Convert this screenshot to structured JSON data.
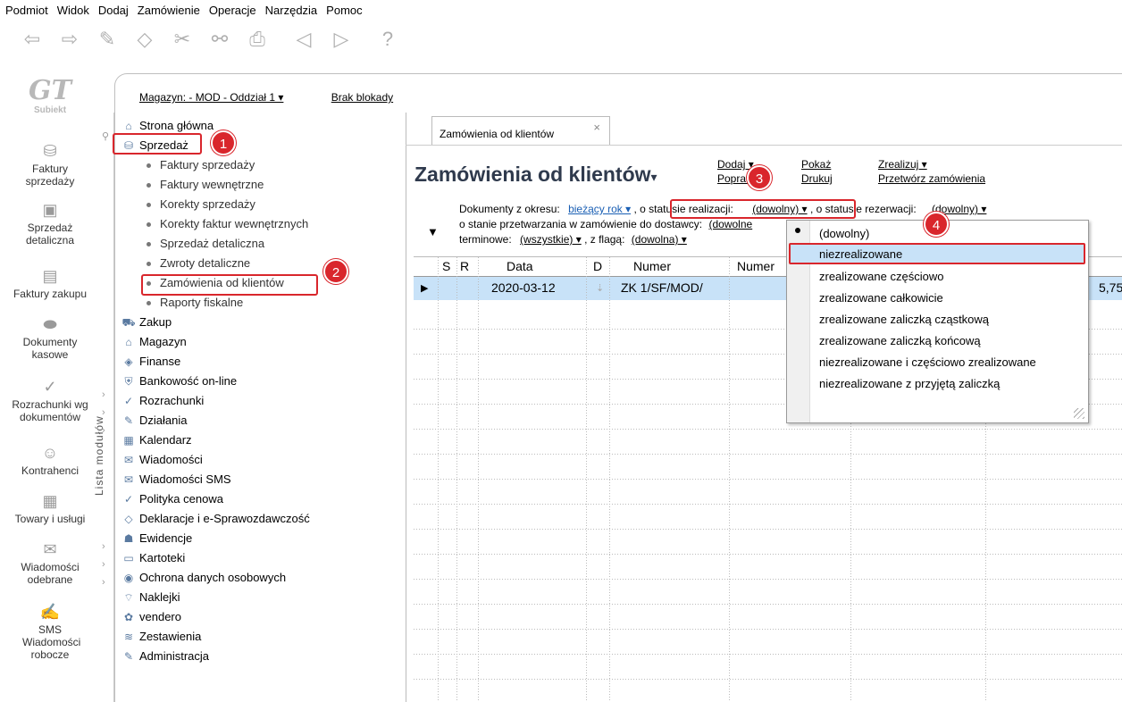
{
  "menu": [
    "Podmiot",
    "Widok",
    "Dodaj",
    "Zamówienie",
    "Operacje",
    "Narzędzia",
    "Pomoc"
  ],
  "toolbar_icons": [
    "back-icon",
    "forward-icon",
    "pen-icon",
    "eraser-icon",
    "tools-icon",
    "link-icon",
    "print-icon",
    "prev-record-icon",
    "next-record-icon",
    "help-icon"
  ],
  "logo": {
    "mark": "GT",
    "name": "Subiekt"
  },
  "rail": [
    {
      "label": "Faktury sprzedaży",
      "icon": "coins-icon"
    },
    {
      "label": "Sprzedaż detaliczna",
      "icon": "register-icon"
    },
    {
      "label": "Faktury zakupu",
      "icon": "invoice-icon"
    },
    {
      "label": "Dokumenty kasowe",
      "icon": "cash-icon"
    },
    {
      "label": "Rozrachunki wg dokumentów",
      "icon": "settlement-icon"
    },
    {
      "label": "Kontrahenci",
      "icon": "contact-icon"
    },
    {
      "label": "Towary i usługi",
      "icon": "box-icon"
    },
    {
      "label": "Wiadomości odebrane",
      "icon": "mail-icon"
    },
    {
      "label": "SMS Wiadomości robocze",
      "icon": "sms-icon"
    }
  ],
  "infobar": {
    "warehouse": "Magazyn: - MOD - Oddział 1 ▾",
    "lock": "Brak blokady"
  },
  "modules_label": "Lista modułów",
  "tree": {
    "home": "Strona główna",
    "sales": "Sprzedaż",
    "sales_items": [
      "Faktury sprzedaży",
      "Faktury wewnętrzne",
      "Korekty sprzedaży",
      "Korekty faktur wewnętrznych",
      "Sprzedaż detaliczna",
      "Zwroty detaliczne",
      "Zamówienia od klientów",
      "Raporty fiskalne"
    ],
    "others": [
      "Zakup",
      "Magazyn",
      "Finanse",
      "Bankowość on-line",
      "Rozrachunki",
      "Działania",
      "Kalendarz",
      "Wiadomości",
      "Wiadomości SMS",
      "Polityka cenowa",
      "Deklaracje i e-Sprawozdawczość",
      "Ewidencje",
      "Kartoteki",
      "Ochrona danych osobowych",
      "Naklejki",
      "vendero",
      "Zestawienia",
      "Administracja"
    ]
  },
  "markers": [
    "1",
    "2",
    "3",
    "4"
  ],
  "tab": {
    "label": "Zamówienia od klientów",
    "close": "×"
  },
  "page": {
    "title": "Zamówienia od klientów",
    "title_caret": "▾"
  },
  "actions": {
    "add": "Dodaj ▾",
    "fix": "Popraw",
    "show": "Pokaż",
    "print": "Drukuj",
    "realize": "Zrealizuj ▾",
    "process": "Przetwórz zamówienia"
  },
  "filters": {
    "period_label": "Dokumenty z okresu:",
    "period_value": "bieżący rok ▾",
    "status_label": ", o statusie realizacji:",
    "status_value": "(dowolny) ▾",
    "reservation_label": ", o statusie rezerwacji:",
    "reservation_value": "(dowolny) ▾",
    "supplier_label": "o stanie przetwarzania w zamówienie do dostawcy:",
    "supplier_value": "(dowolne",
    "term_label": "terminowe:",
    "term_value": "(wszystkie) ▾",
    "flag_label": ", z flagą:",
    "flag_value": "(dowolna) ▾"
  },
  "grid": {
    "headers": [
      "S",
      "R",
      "Data",
      "D",
      "Numer",
      "Numer"
    ],
    "row": {
      "date": "2020-03-12",
      "number": "ZK 1/SF/MOD/",
      "amount": "5,75"
    }
  },
  "dropdown": {
    "items": [
      "(dowolny)",
      "niezrealizowane",
      "zrealizowane częściowo",
      "zrealizowane całkowicie",
      "zrealizowane zaliczką cząstkową",
      "zrealizowane zaliczką końcową",
      "niezrealizowane i częściowo zrealizowane",
      "niezrealizowane z przyjętą zaliczką"
    ],
    "selected_index": 0,
    "highlighted_index": 1
  },
  "colors": {
    "highlight_red": "#d9262c",
    "selection_blue": "#c8e2f8",
    "link_blue": "#1a5fb4"
  }
}
